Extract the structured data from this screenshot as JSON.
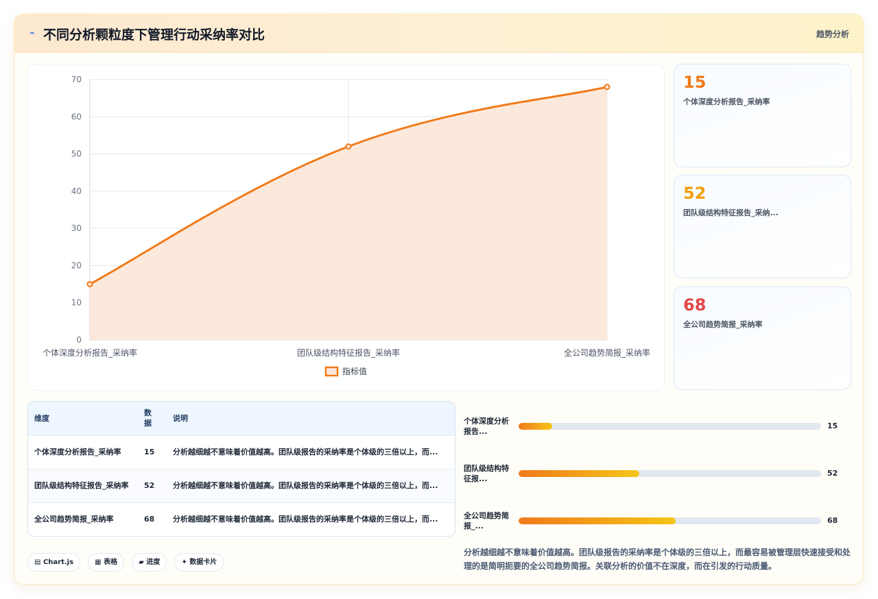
{
  "header": {
    "icon": "trend-icon",
    "title": "不同分析颗粒度下管理行动采纳率对比",
    "tag": "趋势分析"
  },
  "chart_data": {
    "type": "area",
    "categories": [
      "个体深度分析报告_采纳率",
      "团队级结构特征报告_采纳率",
      "全公司趋势简报_采纳率"
    ],
    "series": [
      {
        "name": "指标值",
        "values": [
          15,
          52,
          68
        ]
      }
    ],
    "ylim": [
      0,
      70
    ],
    "yticks": [
      0,
      10,
      20,
      30,
      40,
      50,
      60,
      70
    ],
    "legend": "bottom",
    "grid": true,
    "colors": {
      "line": "#f07a1a",
      "fill": "#fde9dc"
    }
  },
  "kpis": [
    {
      "value": "15",
      "label": "个体深度分析报告_采纳率",
      "color": "#f07a1a"
    },
    {
      "value": "52",
      "label": "团队级结构特征报告_采纳...",
      "color": "#f0a010"
    },
    {
      "value": "68",
      "label": "全公司趋势简报_采纳率",
      "color": "#e04848"
    }
  ],
  "table": {
    "headers": [
      "维度",
      "数据",
      "说明"
    ],
    "rows": [
      {
        "dim": "个体深度分析报告_采纳率",
        "val": "15",
        "note": "分析越细越不意味着价值越高。团队级报告的采纳率是个体级的三倍以上，而..."
      },
      {
        "dim": "团队级结构特征报告_采纳率",
        "val": "52",
        "note": "分析越细越不意味着价值越高。团队级报告的采纳率是个体级的三倍以上，而..."
      },
      {
        "dim": "全公司趋势简报_采纳率",
        "val": "68",
        "note": "分析越细越不意味着价值越高。团队级报告的采纳率是个体级的三倍以上，而..."
      }
    ]
  },
  "progress": [
    {
      "label": "个体深度分析报告...",
      "value": "15",
      "fraction": 0.11
    },
    {
      "label": "团队级结构特征报...",
      "value": "52",
      "fraction": 0.4
    },
    {
      "label": "全公司趋势简报_...",
      "value": "68",
      "fraction": 0.52
    }
  ],
  "summary": "分析越细越不意味着价值越高。团队级报告的采纳率是个体级的三倍以上，而最容易被管理层快速接受和处理的是简明扼要的全公司趋势简报。关联分析的价值不在深度，而在引发的行动质量。",
  "pills": [
    "Chart.js",
    "表格",
    "进度",
    "数据卡片"
  ],
  "pill_icons": [
    "chart-icon",
    "table-icon",
    "progress-icon",
    "card-icon"
  ]
}
